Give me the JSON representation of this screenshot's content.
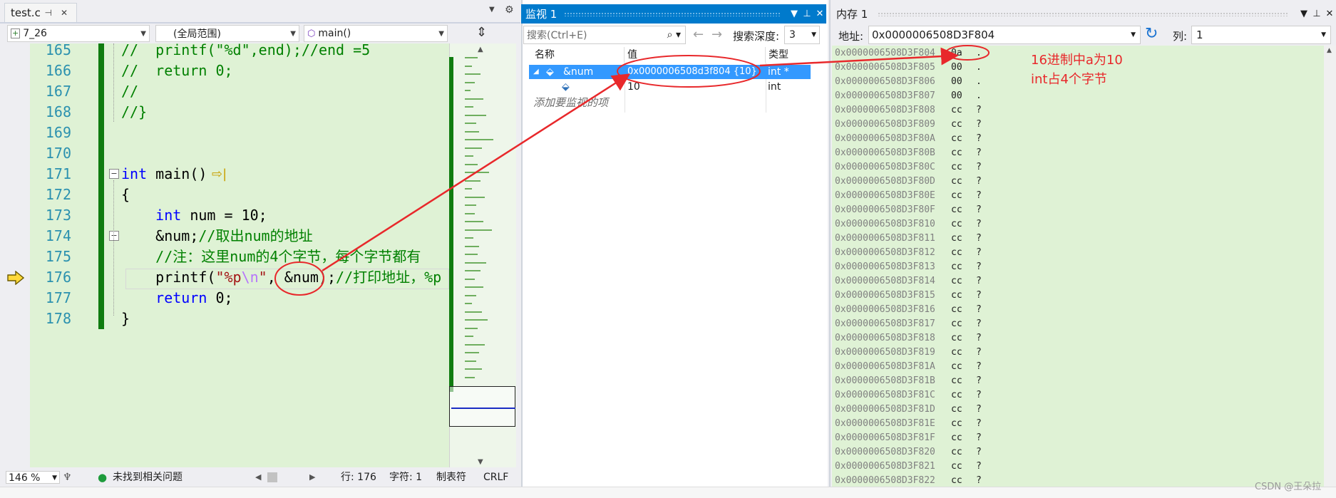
{
  "editor": {
    "tab_title": "test.c",
    "tab_icons": [
      "pin-icon",
      "close-icon"
    ],
    "nav": {
      "project": "7_26",
      "scope": "(全局范围)",
      "function": "main()"
    },
    "lines": [
      {
        "num": "165",
        "parts": [
          [
            "cmt",
            "//  printf(\"%d\",end);//end =5"
          ]
        ]
      },
      {
        "num": "166",
        "parts": [
          [
            "cmt",
            "//  return 0;"
          ]
        ]
      },
      {
        "num": "167",
        "parts": [
          [
            "cmt",
            "//"
          ]
        ]
      },
      {
        "num": "168",
        "parts": [
          [
            "cmt",
            "//}"
          ]
        ]
      },
      {
        "num": "169",
        "parts": []
      },
      {
        "num": "170",
        "parts": []
      },
      {
        "num": "171",
        "parts": [
          [
            "kw",
            "int"
          ],
          [
            "",
            " main() "
          ]
        ]
      },
      {
        "num": "172",
        "parts": [
          [
            "",
            "{"
          ]
        ]
      },
      {
        "num": "173",
        "parts": [
          [
            "",
            "    "
          ],
          [
            "kw",
            "int"
          ],
          [
            "",
            " num = 10;"
          ]
        ]
      },
      {
        "num": "174",
        "parts": [
          [
            "",
            "    &num;"
          ],
          [
            "cmt",
            "//取出num的地址"
          ]
        ]
      },
      {
        "num": "175",
        "parts": [
          [
            "",
            "    "
          ],
          [
            "cmt",
            "//注：这里num的4个字节，每个字节都有"
          ]
        ]
      },
      {
        "num": "176",
        "parts": [
          [
            "",
            "    printf("
          ],
          [
            "str",
            "\"%p"
          ],
          [
            "esc",
            "\\n"
          ],
          [
            "str",
            "\""
          ],
          [
            "",
            ", &num);"
          ],
          [
            "cmt",
            "//打印地址，%p"
          ]
        ]
      },
      {
        "num": "177",
        "parts": [
          [
            "",
            "    "
          ],
          [
            "kw",
            "return"
          ],
          [
            "",
            " 0;"
          ]
        ]
      },
      {
        "num": "178",
        "parts": [
          [
            "",
            "}"
          ]
        ]
      }
    ],
    "status": {
      "zoom": "146 %",
      "issues": "未找到相关问题",
      "line": "行: 176",
      "char": "字符: 1",
      "tab_mode": "制表符",
      "eol": "CRLF"
    }
  },
  "watch": {
    "title": "监视 1",
    "search_placeholder": "搜索(Ctrl+E)",
    "depth_label": "搜索深度:",
    "depth_value": "3",
    "columns": {
      "name": "名称",
      "value": "值",
      "type": "类型"
    },
    "rows": [
      {
        "name": "&num",
        "value": "0x0000006508d3f804 {10}",
        "type": "int *",
        "selected": true
      },
      {
        "name": "",
        "value": "10",
        "type": "int",
        "selected": false
      }
    ],
    "add_item": "添加要监视的项"
  },
  "memory": {
    "title": "内存 1",
    "address_label": "地址:",
    "address_value": "0x0000006508D3F804",
    "column_label": "列:",
    "column_value": "1",
    "rows": [
      {
        "addr": "0x0000006508D3F804",
        "byte": "0a",
        "chr": "."
      },
      {
        "addr": "0x0000006508D3F805",
        "byte": "00",
        "chr": "."
      },
      {
        "addr": "0x0000006508D3F806",
        "byte": "00",
        "chr": "."
      },
      {
        "addr": "0x0000006508D3F807",
        "byte": "00",
        "chr": "."
      },
      {
        "addr": "0x0000006508D3F808",
        "byte": "cc",
        "chr": "?"
      },
      {
        "addr": "0x0000006508D3F809",
        "byte": "cc",
        "chr": "?"
      },
      {
        "addr": "0x0000006508D3F80A",
        "byte": "cc",
        "chr": "?"
      },
      {
        "addr": "0x0000006508D3F80B",
        "byte": "cc",
        "chr": "?"
      },
      {
        "addr": "0x0000006508D3F80C",
        "byte": "cc",
        "chr": "?"
      },
      {
        "addr": "0x0000006508D3F80D",
        "byte": "cc",
        "chr": "?"
      },
      {
        "addr": "0x0000006508D3F80E",
        "byte": "cc",
        "chr": "?"
      },
      {
        "addr": "0x0000006508D3F80F",
        "byte": "cc",
        "chr": "?"
      },
      {
        "addr": "0x0000006508D3F810",
        "byte": "cc",
        "chr": "?"
      },
      {
        "addr": "0x0000006508D3F811",
        "byte": "cc",
        "chr": "?"
      },
      {
        "addr": "0x0000006508D3F812",
        "byte": "cc",
        "chr": "?"
      },
      {
        "addr": "0x0000006508D3F813",
        "byte": "cc",
        "chr": "?"
      },
      {
        "addr": "0x0000006508D3F814",
        "byte": "cc",
        "chr": "?"
      },
      {
        "addr": "0x0000006508D3F815",
        "byte": "cc",
        "chr": "?"
      },
      {
        "addr": "0x0000006508D3F816",
        "byte": "cc",
        "chr": "?"
      },
      {
        "addr": "0x0000006508D3F817",
        "byte": "cc",
        "chr": "?"
      },
      {
        "addr": "0x0000006508D3F818",
        "byte": "cc",
        "chr": "?"
      },
      {
        "addr": "0x0000006508D3F819",
        "byte": "cc",
        "chr": "?"
      },
      {
        "addr": "0x0000006508D3F81A",
        "byte": "cc",
        "chr": "?"
      },
      {
        "addr": "0x0000006508D3F81B",
        "byte": "cc",
        "chr": "?"
      },
      {
        "addr": "0x0000006508D3F81C",
        "byte": "cc",
        "chr": "?"
      },
      {
        "addr": "0x0000006508D3F81D",
        "byte": "cc",
        "chr": "?"
      },
      {
        "addr": "0x0000006508D3F81E",
        "byte": "cc",
        "chr": "?"
      },
      {
        "addr": "0x0000006508D3F81F",
        "byte": "cc",
        "chr": "?"
      },
      {
        "addr": "0x0000006508D3F820",
        "byte": "cc",
        "chr": "?"
      },
      {
        "addr": "0x0000006508D3F821",
        "byte": "cc",
        "chr": "?"
      },
      {
        "addr": "0x0000006508D3F822",
        "byte": "cc",
        "chr": "?"
      }
    ]
  },
  "annotation": {
    "line1": "16进制中a为10",
    "line2": "int占4个字节",
    "color": "#e8282b"
  },
  "watermark": "CSDN @王朵拉",
  "colors": {
    "accent": "#007acc",
    "selection": "#3399ff",
    "code_bg": "#dff2d5",
    "change_bar": "#107c10"
  }
}
